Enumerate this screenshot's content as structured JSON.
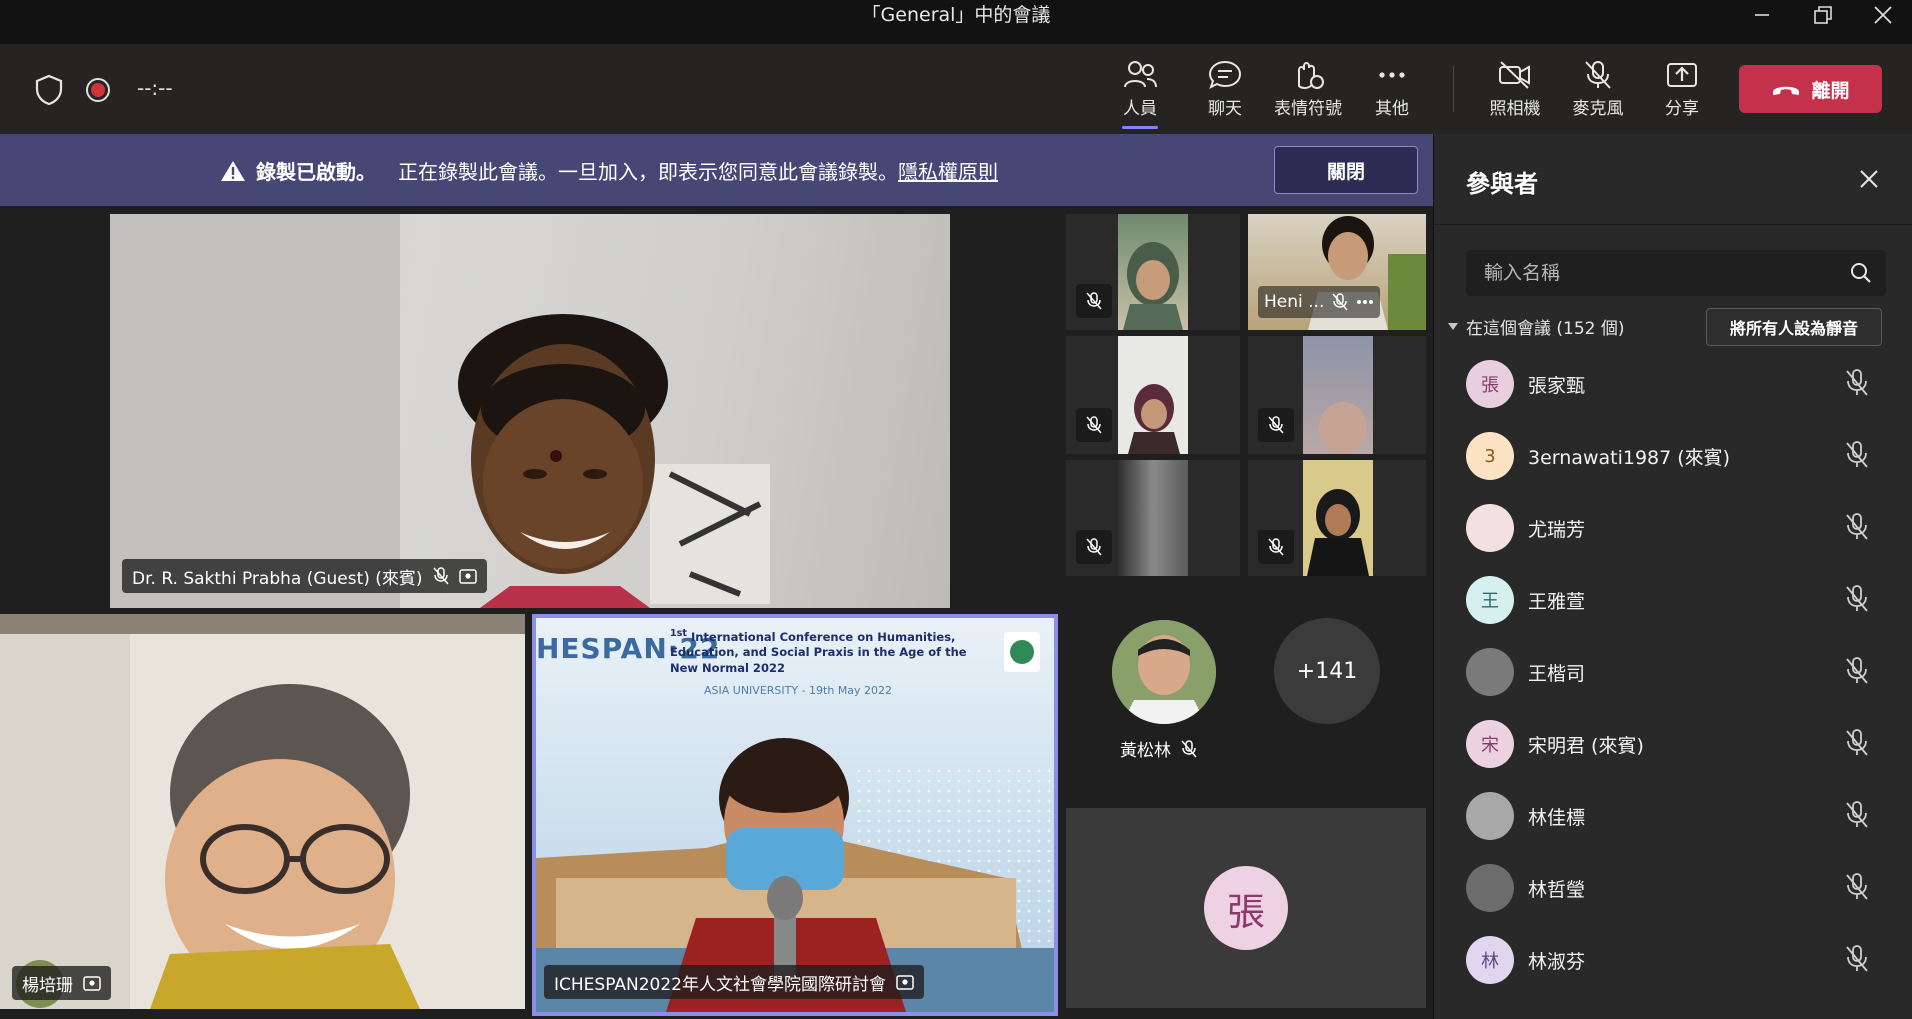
{
  "window": {
    "title": "「General」中的會議"
  },
  "toolbar": {
    "timer": "--:--",
    "people": "人員",
    "chat": "聊天",
    "reactions": "表情符號",
    "more": "其他",
    "camera": "照相機",
    "mic": "麥克風",
    "share": "分享",
    "leave": "離開"
  },
  "banner": {
    "bold": "錄製已啟動。",
    "text": "正在錄製此會議。一旦加入，即表示您同意此會議錄製。",
    "link": "隱私權原則",
    "close": "關閉"
  },
  "stage": {
    "speaker_main": "Dr. R. Sakthi Prabha (Guest) (來賓)",
    "speaker_left": "楊培珊",
    "speaker_right": "ICHESPAN2022年人文社會學院國際研討會",
    "slide": {
      "logo": "HESPAN·22",
      "headline": "International Conference on Humanities, Education, and Social Praxis in the Age of the New Normal 2022",
      "prefix": "1st",
      "subtitle": "ASIA UNIVERSITY - 19th May 2022"
    },
    "heni": "Heni ...",
    "huang": "黃松林",
    "more_count": "+141",
    "zhang_initial": "張"
  },
  "panel": {
    "title": "參與者",
    "search_placeholder": "輸入名稱",
    "group_label": "在這個會議 (152 個)",
    "mute_all": "將所有人設為靜音",
    "participants": [
      {
        "name": "張家甄",
        "initial": "張",
        "color": "#e8cfe0",
        "fg": "#8a3a6b"
      },
      {
        "name": "3ernawati1987 (來賓)",
        "initial": "3",
        "color": "#fbe3c4",
        "fg": "#8a5a1a"
      },
      {
        "name": "尤瑞芳",
        "initial": "",
        "color": "#f3e0e0",
        "fg": "#333"
      },
      {
        "name": "王雅萱",
        "initial": "王",
        "color": "#d6f0f0",
        "fg": "#2f6b6b"
      },
      {
        "name": "王楷司",
        "initial": "",
        "color": "#7a7a7a",
        "fg": "#fff"
      },
      {
        "name": "宋明君 (來賓)",
        "initial": "宋",
        "color": "#ecd2e0",
        "fg": "#8a3a6b"
      },
      {
        "name": "林佳標",
        "initial": "",
        "color": "#a8a8a8",
        "fg": "#fff"
      },
      {
        "name": "林哲瑩",
        "initial": "",
        "color": "#6c6c6c",
        "fg": "#fff"
      },
      {
        "name": "林淑芬",
        "initial": "林",
        "color": "#e0d6ee",
        "fg": "#5a4a80"
      }
    ]
  }
}
